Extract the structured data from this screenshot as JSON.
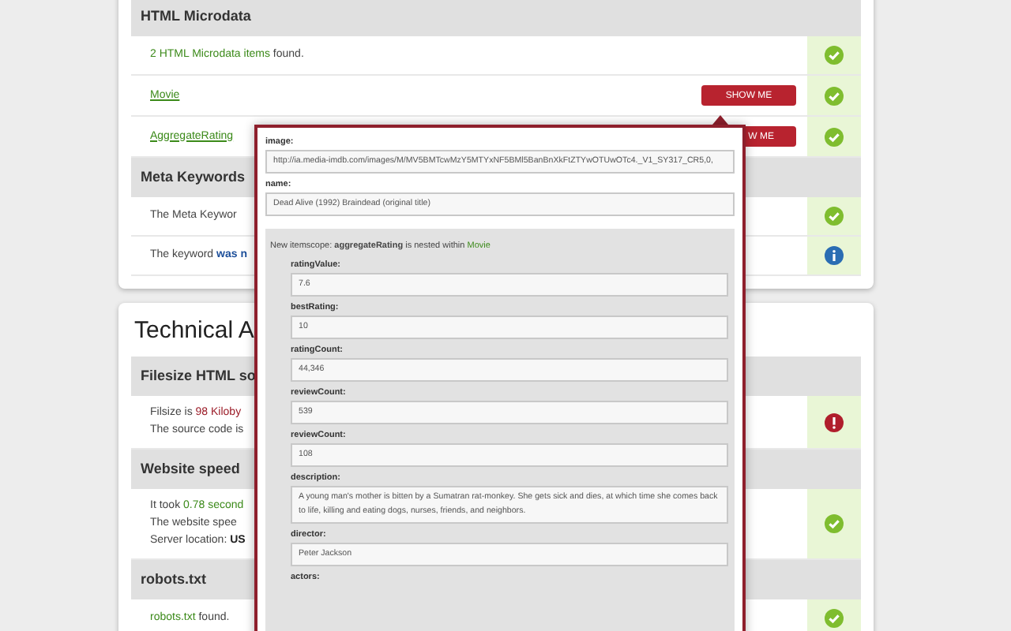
{
  "cards": [
    {
      "blocks": [
        {
          "kind": "header",
          "text": "HTML Microdata"
        },
        {
          "kind": "row",
          "status": {
            "kind": "ok"
          },
          "lines": [
            [
              {
                "text": "2 HTML Microdata items",
                "kind": "good"
              },
              {
                "text": " found.",
                "kind": "plain"
              }
            ]
          ]
        },
        {
          "kind": "row",
          "status": {
            "kind": "ok"
          },
          "lines": [
            [
              {
                "text": "Movie",
                "kind": "link"
              }
            ]
          ],
          "button": "SHOW ME"
        },
        {
          "kind": "row",
          "status": {
            "kind": "ok"
          },
          "lines": [
            [
              {
                "text": "AggregateRating",
                "kind": "link"
              }
            ]
          ],
          "button": "W ME"
        },
        {
          "kind": "header",
          "text": "Meta Keywords"
        },
        {
          "kind": "row",
          "status": {
            "kind": "ok"
          },
          "lines": [
            [
              {
                "text": "The Meta Keywor",
                "kind": "plain"
              }
            ]
          ]
        },
        {
          "kind": "row",
          "status": {
            "kind": "info"
          },
          "lines": [
            [
              {
                "text": "The keyword ",
                "kind": "plain"
              },
              {
                "text": "was n",
                "kind": "accent"
              }
            ]
          ]
        }
      ]
    },
    {
      "title": "Technical A",
      "blocks": [
        {
          "kind": "header",
          "text": "Filesize HTML so"
        },
        {
          "kind": "row",
          "status": {
            "kind": "error"
          },
          "lines": [
            [
              {
                "text": "Filsize is ",
                "kind": "plain"
              },
              {
                "text": "98 Kiloby",
                "kind": "bad"
              }
            ],
            [
              {
                "text": "The source code is",
                "kind": "plain"
              }
            ]
          ]
        },
        {
          "kind": "header",
          "text": "Website speed"
        },
        {
          "kind": "row",
          "status": {
            "kind": "ok"
          },
          "lines": [
            [
              {
                "text": "It took ",
                "kind": "plain"
              },
              {
                "text": "0.78 second",
                "kind": "good"
              }
            ],
            [
              {
                "text": "The website spee",
                "kind": "plain"
              }
            ],
            [
              {
                "text": "Server location: ",
                "kind": "plain"
              },
              {
                "text": "US",
                "kind": "strong"
              }
            ]
          ]
        },
        {
          "kind": "header",
          "text": "robots.txt"
        },
        {
          "kind": "row",
          "status": {
            "kind": "ok"
          },
          "lines": [
            [
              {
                "text": "robots.txt",
                "kind": "good"
              },
              {
                "text": " found.",
                "kind": "plain"
              }
            ]
          ]
        }
      ]
    }
  ],
  "popup": {
    "fields": [
      {
        "label": "image:",
        "value": "http://ia.media-imdb.com/images/M/MV5BMTcwMzY5MTYxNF5BMl5BanBnXkFtZTYwOTUwOTc4._V1_SY317_CR5,0,"
      },
      {
        "label": "name:",
        "value": "Dead Alive (1992) Braindead (original title)"
      }
    ],
    "nested": {
      "prefix": "New itemscope: ",
      "property": "aggregateRating",
      "middle": " is nested within ",
      "parent": "Movie",
      "fields": [
        {
          "label": "ratingValue:",
          "value": "7.6"
        },
        {
          "label": "bestRating:",
          "value": "10"
        },
        {
          "label": "ratingCount:",
          "value": "44,346"
        },
        {
          "label": "reviewCount:",
          "value": "539"
        },
        {
          "label": "reviewCount:",
          "value": "108"
        },
        {
          "label": "description:",
          "value": "A young man's mother is bitten by a Sumatran rat-monkey. She gets sick and dies, at which time she comes back to life, killing and eating dogs, nurses, friends, and neighbors."
        },
        {
          "label": "director:",
          "value": "Peter Jackson"
        },
        {
          "label": "actors:"
        }
      ]
    }
  }
}
